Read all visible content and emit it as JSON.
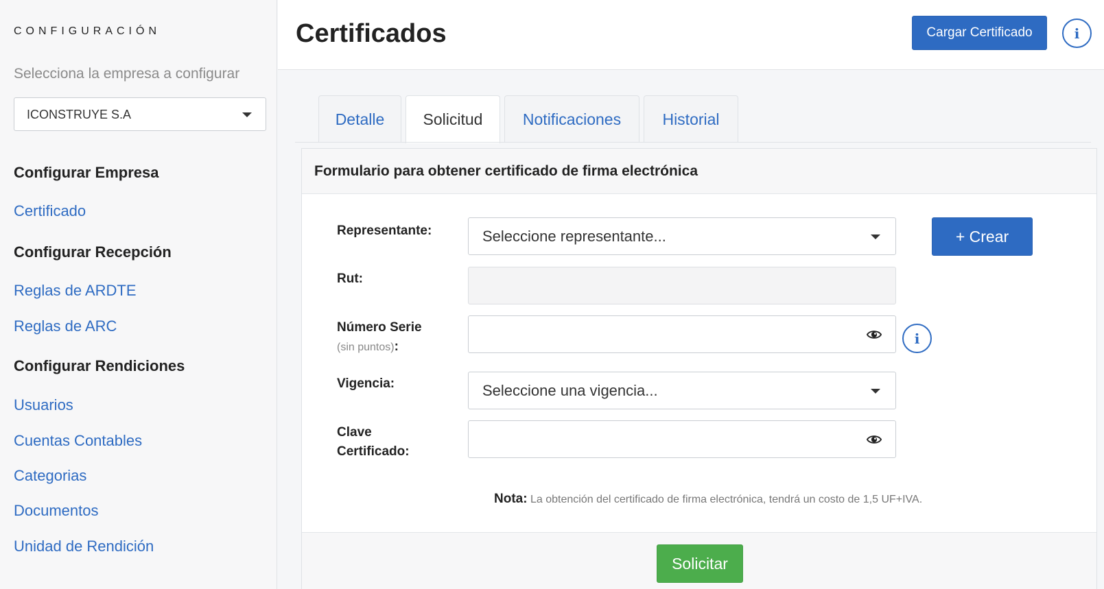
{
  "sidebar": {
    "heading": "CONFIGURACIÓN",
    "subtitle": "Selecciona la empresa a configurar",
    "company_selected": "ICONSTRUYE S.A",
    "sections": [
      {
        "title": "Configurar Empresa",
        "links": [
          "Certificado"
        ]
      },
      {
        "title": "Configurar Recepción",
        "links": [
          "Reglas de ARDTE",
          "Reglas de ARC"
        ]
      },
      {
        "title": "Configurar Rendiciones",
        "links": [
          "Usuarios",
          "Cuentas Contables",
          "Categorias",
          "Documentos",
          "Unidad de Rendición"
        ]
      }
    ]
  },
  "header": {
    "title": "Certificados",
    "load_button": "Cargar Certificado",
    "info_icon": "i"
  },
  "tabs": [
    {
      "label": "Detalle",
      "active": false
    },
    {
      "label": "Solicitud",
      "active": true
    },
    {
      "label": "Notificaciones",
      "active": false
    },
    {
      "label": "Historial",
      "active": false
    }
  ],
  "form": {
    "title": "Formulario para obtener certificado de firma electrónica",
    "representante_label": "Representante:",
    "representante_placeholder": "Seleccione representante...",
    "crear_button": "+ Crear",
    "rut_label": "Rut:",
    "rut_value": "",
    "serie_label": "Número Serie",
    "serie_hint": "(sin puntos)",
    "serie_colon": ":",
    "serie_value": "",
    "vigencia_label": "Vigencia:",
    "vigencia_placeholder": "Seleccione una vigencia...",
    "clave_label_1": "Clave",
    "clave_label_2": "Certificado:",
    "clave_value": "",
    "info_icon": "i",
    "note_label": "Nota:",
    "note_text": "La obtención del certificado de firma electrónica, tendrá un costo de 1,5 UF+IVA.",
    "submit_button": "Solicitar"
  },
  "colors": {
    "primary": "#2e6bc2",
    "success": "#4cad4c",
    "link": "#2e6bc2"
  },
  "icons": [
    "chevron-down-icon",
    "eye-icon",
    "info-icon"
  ]
}
